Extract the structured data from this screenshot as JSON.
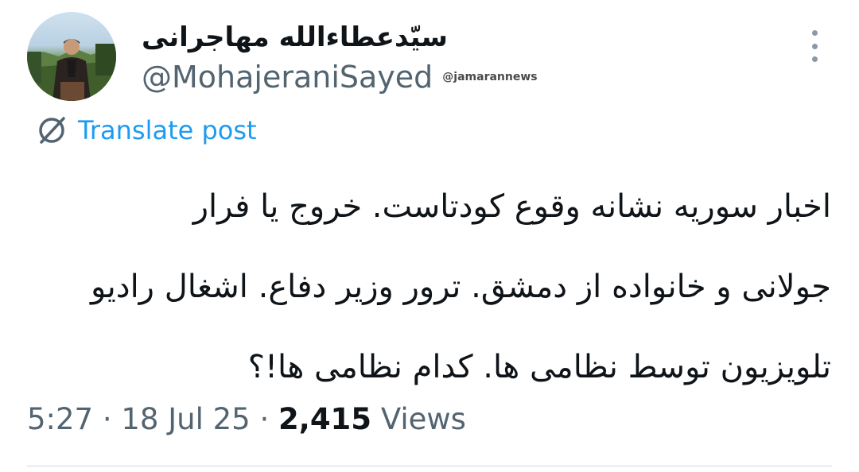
{
  "author": {
    "display_name": "سیّدعطاءالله مهاجرانی",
    "handle": "@MohajeraniSayed",
    "watermark": "@jamarannews"
  },
  "translate": {
    "label": "Translate post",
    "icon": "translate-globe-icon",
    "color": "#1d9bf0"
  },
  "post": {
    "lines": [
      "اخبار سوریه نشانه وقوع کودتاست. خروج یا فرار",
      "جولانی و خانواده از دمشق. ترور وزیر دفاع. اشغال رادیو",
      "تلویزیون توسط نظامی ها. کدام نظامی ها!؟"
    ]
  },
  "meta": {
    "time": "5:27",
    "separator": "·",
    "date": "18 Jul 25",
    "views_count": "2,415",
    "views_label": "Views"
  },
  "colors": {
    "text": "#0f1419",
    "secondary": "#536471",
    "accent": "#1d9bf0",
    "divider": "#cfd9de"
  }
}
